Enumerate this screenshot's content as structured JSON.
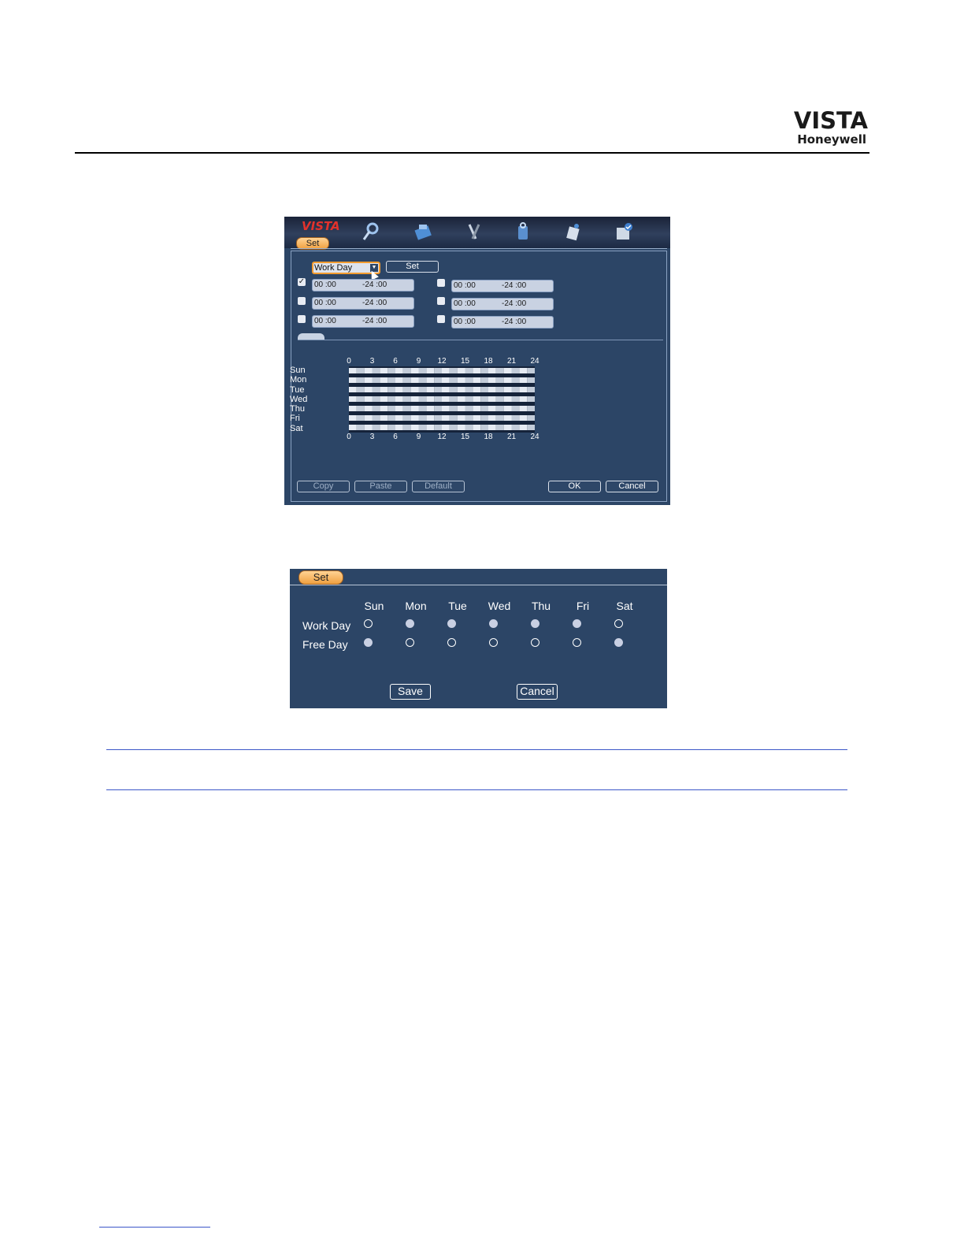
{
  "logo": {
    "brand": "VISTA",
    "maker": "Honeywell"
  },
  "schedule_window": {
    "brand": "VISTA",
    "menu_icons": [
      "search-icon",
      "record-icon",
      "tools-icon",
      "storage-icon",
      "network-icon",
      "system-icon"
    ],
    "tab_label": "Set",
    "day_type": "Work Day",
    "set_button": "Set",
    "periods": [
      {
        "checked": true,
        "start": "00 :00",
        "end": "-24 :00"
      },
      {
        "checked": false,
        "start": "00 :00",
        "end": "-24 :00"
      },
      {
        "checked": false,
        "start": "00 :00",
        "end": "-24 :00"
      },
      {
        "checked": false,
        "start": "00 :00",
        "end": "-24 :00"
      },
      {
        "checked": false,
        "start": "00 :00",
        "end": "-24 :00"
      },
      {
        "checked": false,
        "start": "00 :00",
        "end": "-24 :00"
      }
    ],
    "weekdays": [
      "Sun",
      "Mon",
      "Tue",
      "Wed",
      "Thu",
      "Fri",
      "Sat"
    ],
    "hour_ticks": [
      "0",
      "3",
      "6",
      "9",
      "12",
      "15",
      "18",
      "21",
      "24"
    ],
    "buttons": {
      "copy": "Copy",
      "paste": "Paste",
      "default": "Default",
      "ok": "OK",
      "cancel": "Cancel"
    }
  },
  "set_dialog": {
    "tab_label": "Set",
    "columns": [
      "Sun",
      "Mon",
      "Tue",
      "Wed",
      "Thu",
      "Fri",
      "Sat"
    ],
    "rows": [
      {
        "label": "Work Day",
        "selected": [
          false,
          true,
          true,
          true,
          true,
          true,
          false
        ]
      },
      {
        "label": "Free Day",
        "selected": [
          true,
          false,
          false,
          false,
          false,
          false,
          true
        ]
      }
    ],
    "save": "Save",
    "cancel": "Cancel"
  }
}
